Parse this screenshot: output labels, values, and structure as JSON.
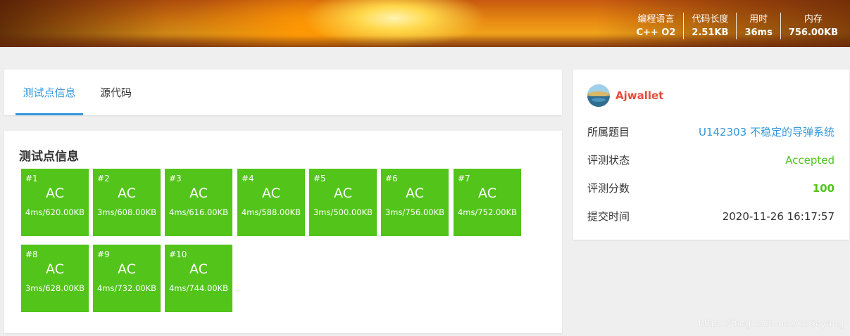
{
  "header": {
    "stats": [
      {
        "label": "编程语言",
        "value": "C++ O2"
      },
      {
        "label": "代码长度",
        "value": "2.51KB"
      },
      {
        "label": "用时",
        "value": "36ms"
      },
      {
        "label": "内存",
        "value": "756.00KB"
      }
    ]
  },
  "tabs": [
    {
      "label": "测试点信息",
      "active": true
    },
    {
      "label": "源代码",
      "active": false
    }
  ],
  "tests": {
    "title": "测试点信息",
    "status_color": "#52c41a",
    "items": [
      {
        "num": "#1",
        "status": "AC",
        "detail": "4ms/620.00KB"
      },
      {
        "num": "#2",
        "status": "AC",
        "detail": "3ms/608.00KB"
      },
      {
        "num": "#3",
        "status": "AC",
        "detail": "4ms/616.00KB"
      },
      {
        "num": "#4",
        "status": "AC",
        "detail": "4ms/588.00KB"
      },
      {
        "num": "#5",
        "status": "AC",
        "detail": "3ms/500.00KB"
      },
      {
        "num": "#6",
        "status": "AC",
        "detail": "3ms/756.00KB"
      },
      {
        "num": "#7",
        "status": "AC",
        "detail": "4ms/752.00KB"
      },
      {
        "num": "#8",
        "status": "AC",
        "detail": "3ms/628.00KB"
      },
      {
        "num": "#9",
        "status": "AC",
        "detail": "4ms/732.00KB"
      },
      {
        "num": "#10",
        "status": "AC",
        "detail": "4ms/744.00KB"
      }
    ]
  },
  "info": {
    "username": "Ajwallet",
    "username_color": "#e74c3c",
    "avatar_icon": "avatar-image",
    "rows": [
      {
        "key": "所属题目",
        "value": "U142303 不稳定的导弹系统"
      },
      {
        "key": "评测状态",
        "value": "Accepted"
      },
      {
        "key": "评测分数",
        "value": "100"
      },
      {
        "key": "提交时间",
        "value": "2020-11-26 16:17:57"
      }
    ]
  },
  "watermark": "https://blog.csdn.net/xuxiayang"
}
